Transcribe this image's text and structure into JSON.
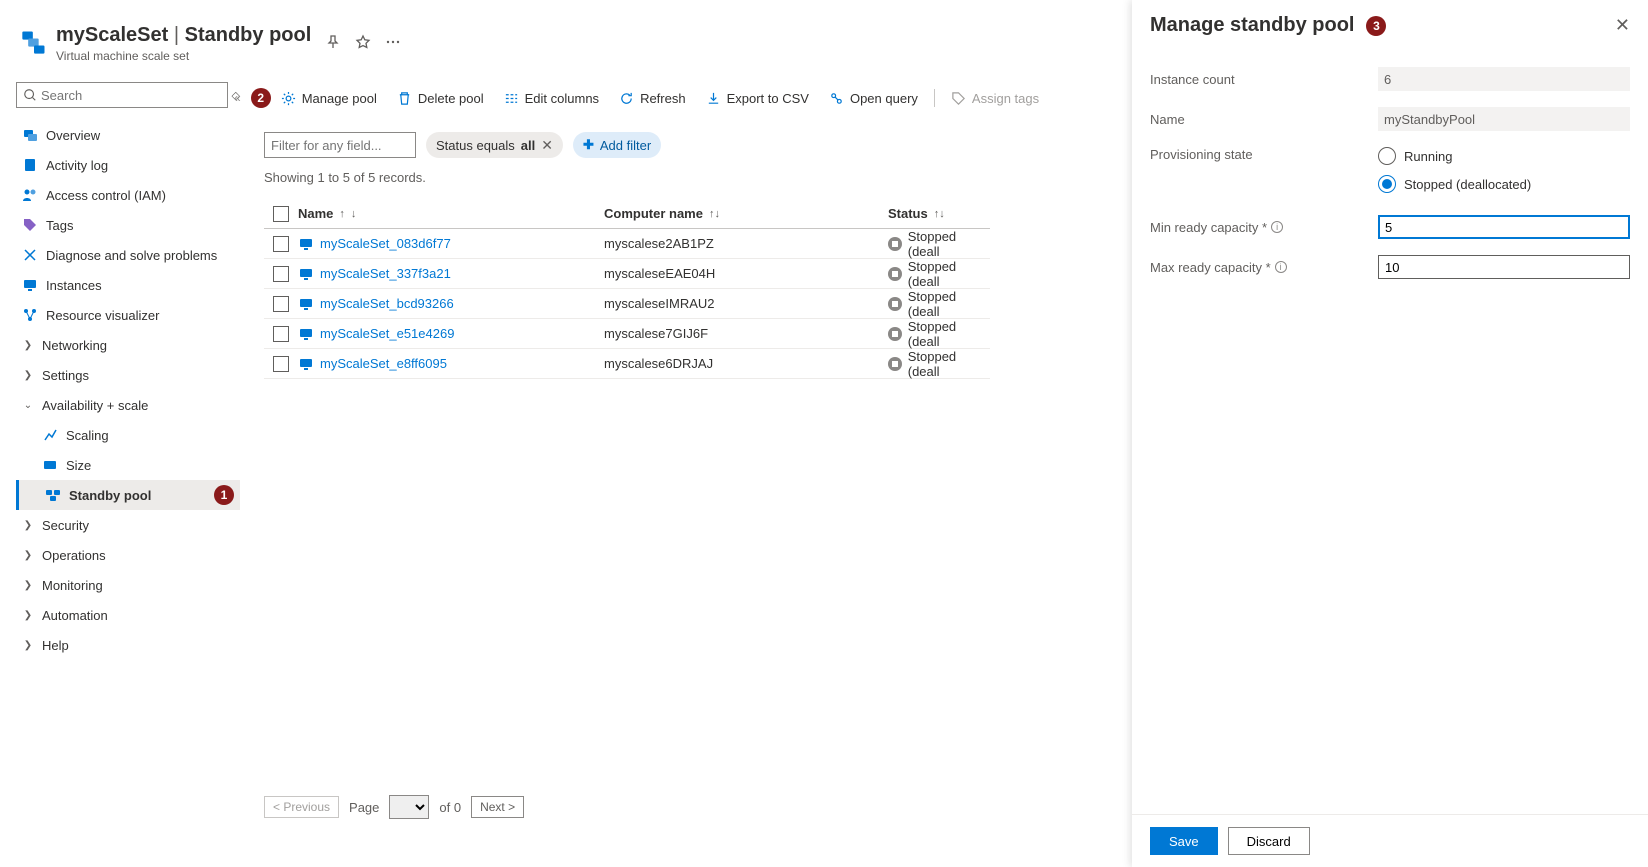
{
  "header": {
    "resource_name": "myScaleSet",
    "separator": " | ",
    "page_title": "Standby pool",
    "resource_type": "Virtual machine scale set"
  },
  "search": {
    "placeholder": "Search"
  },
  "sidebar": {
    "overview": "Overview",
    "activity": "Activity log",
    "iam": "Access control (IAM)",
    "tags": "Tags",
    "diag": "Diagnose and solve problems",
    "instances": "Instances",
    "rviz": "Resource visualizer",
    "networking": "Networking",
    "settings": "Settings",
    "avail": "Availability + scale",
    "scaling": "Scaling",
    "size": "Size",
    "standby": "Standby pool",
    "security": "Security",
    "operations": "Operations",
    "monitoring": "Monitoring",
    "automation": "Automation",
    "help": "Help"
  },
  "badges": {
    "b1": "1",
    "b2": "2",
    "b3": "3"
  },
  "toolbar": {
    "manage": "Manage pool",
    "delete": "Delete pool",
    "cols": "Edit columns",
    "refresh": "Refresh",
    "csv": "Export to CSV",
    "open": "Open query",
    "assign": "Assign tags"
  },
  "filters": {
    "placeholder": "Filter for any field...",
    "status_pre": "Status equals ",
    "status_val": "all",
    "add": "Add filter"
  },
  "records_text": "Showing 1 to 5 of 5 records.",
  "columns": {
    "name": "Name",
    "computer": "Computer name",
    "status": "Status"
  },
  "rows": [
    {
      "name": "myScaleSet_083d6f77",
      "computer": "myscalese2AB1PZ",
      "status": "Stopped (deall"
    },
    {
      "name": "myScaleSet_337f3a21",
      "computer": "myscaleseEAE04H",
      "status": "Stopped (deall"
    },
    {
      "name": "myScaleSet_bcd93266",
      "computer": "myscaleseIMRAU2",
      "status": "Stopped (deall"
    },
    {
      "name": "myScaleSet_e51e4269",
      "computer": "myscalese7GIJ6F",
      "status": "Stopped (deall"
    },
    {
      "name": "myScaleSet_e8ff6095",
      "computer": "myscalese6DRJAJ",
      "status": "Stopped (deall"
    }
  ],
  "pager": {
    "prev": "< Previous",
    "page_label": "Page",
    "of_label": "of 0",
    "next": "Next >"
  },
  "panel": {
    "title": "Manage standby pool",
    "instance_count_label": "Instance count",
    "instance_count_value": "6",
    "name_label": "Name",
    "name_value": "myStandbyPool",
    "prov_label": "Provisioning state",
    "opt_running": "Running",
    "opt_stopped": "Stopped (deallocated)",
    "min_label": "Min ready capacity *",
    "min_value": "5",
    "max_label": "Max ready capacity *",
    "max_value": "10",
    "save": "Save",
    "discard": "Discard"
  }
}
